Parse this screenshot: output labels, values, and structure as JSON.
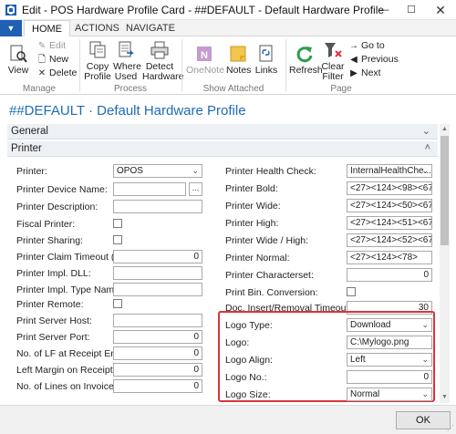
{
  "window": {
    "title": "Edit - POS Hardware Profile Card - ##DEFAULT - Default Hardware Profile",
    "minimize_glyph": "—",
    "maximize_glyph": "☐",
    "close_glyph": "✕"
  },
  "tabs": {
    "app_menu_glyph": "▼",
    "items": [
      "HOME",
      "ACTIONS",
      "NAVIGATE"
    ],
    "active": "HOME"
  },
  "ribbon": {
    "manage": {
      "label": "Manage",
      "view": "View",
      "edit": "Edit",
      "new": "New",
      "delete": "Delete"
    },
    "process": {
      "label": "Process",
      "copy_profile": [
        "Copy",
        "Profile"
      ],
      "where_used": [
        "Where",
        "Used"
      ],
      "detect_hardware": [
        "Detect",
        "Hardware"
      ]
    },
    "show_attached": {
      "label": "Show Attached",
      "onenote": "OneNote",
      "notes": "Notes",
      "links": "Links"
    },
    "page": {
      "label": "Page",
      "refresh": "Refresh",
      "clear_filter": [
        "Clear",
        "Filter"
      ],
      "goto": "Go to",
      "previous": "Previous",
      "next": "Next"
    }
  },
  "page": {
    "title": "##DEFAULT · Default Hardware Profile",
    "general_tab": "General",
    "printer_tab": "Printer",
    "chevron_down": "⌄",
    "chevron_up": "˄"
  },
  "left_fields": {
    "printer": {
      "label": "Printer:",
      "value": "OPOS"
    },
    "printer_device_name": {
      "label": "Printer Device Name:",
      "value": "",
      "assist": "..."
    },
    "printer_description": {
      "label": "Printer Description:",
      "value": ""
    },
    "fiscal_printer": {
      "label": "Fiscal Printer:",
      "checked": false
    },
    "printer_sharing": {
      "label": "Printer Sharing:",
      "checked": false
    },
    "printer_claim_timeout": {
      "label": "Printer Claim Timeout (s):",
      "value": "0"
    },
    "printer_impl_dll": {
      "label": "Printer Impl. DLL:",
      "value": ""
    },
    "printer_impl_type_name": {
      "label": "Printer Impl. Type Name:",
      "value": ""
    },
    "printer_remote": {
      "label": "Printer Remote:",
      "checked": false
    },
    "print_server_host": {
      "label": "Print Server Host:",
      "value": ""
    },
    "print_server_port": {
      "label": "Print Server Port:",
      "value": "0"
    },
    "lf_at_receipt_end": {
      "label": "No. of LF at Receipt End:",
      "value": "0"
    },
    "left_margin_on_receipt": {
      "label": "Left Margin on Receipt:",
      "value": "0"
    },
    "lines_on_invoice": {
      "label": "No. of Lines on Invoice:",
      "value": "0"
    }
  },
  "right_fields": {
    "printer_health_check": {
      "label": "Printer Health Check:",
      "value": "InternalHealthChe..."
    },
    "printer_bold": {
      "label": "Printer Bold:",
      "value": "<27><124><98><67>"
    },
    "printer_wide": {
      "label": "Printer Wide:",
      "value": "<27><124><50><67>"
    },
    "printer_high": {
      "label": "Printer High:",
      "value": "<27><124><51><67>"
    },
    "printer_wide_high": {
      "label": "Printer Wide / High:",
      "value": "<27><124><52><67>"
    },
    "printer_normal": {
      "label": "Printer Normal:",
      "value": "<27><124><78>"
    },
    "printer_characterset": {
      "label": "Printer Characterset:",
      "value": "0"
    },
    "print_bin_conversion": {
      "label": "Print Bin. Conversion:",
      "checked": false
    },
    "doc_insert_removal_timeout": {
      "label": "Doc. Insert/Removal Timeout (s):",
      "value": "30"
    },
    "logo_type": {
      "label": "Logo Type:",
      "value": "Download"
    },
    "logo": {
      "label": "Logo:",
      "value": "C:\\Mylogo.png"
    },
    "logo_align": {
      "label": "Logo Align:",
      "value": "Left"
    },
    "logo_no": {
      "label": "Logo No.:",
      "value": "0"
    },
    "logo_size": {
      "label": "Logo Size:",
      "value": "Normal"
    }
  },
  "dropdown_glyph": "⌄",
  "footer": {
    "ok": "OK",
    "grip": "⋰"
  },
  "colors": {
    "accent": "#1f5fb4",
    "title_blue": "#1e6cb5",
    "highlight": "#d9343b"
  }
}
